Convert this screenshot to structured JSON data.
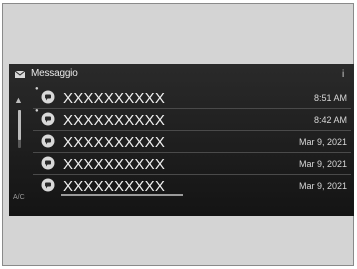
{
  "header": {
    "title": "Messaggio",
    "info_icon": "info-icon",
    "mail_icon": "envelope-icon"
  },
  "sidebar": {
    "up_icon": "up-arrow-icon",
    "ac_label": "A/C"
  },
  "messages": [
    {
      "sender": "XXXXXXXXXX",
      "time": "8:51 AM",
      "unread": true,
      "icon": "message-bubble-icon"
    },
    {
      "sender": "XXXXXXXXXX",
      "time": "8:42 AM",
      "unread": true,
      "icon": "message-bubble-icon"
    },
    {
      "sender": "XXXXXXXXXX",
      "time": "Mar 9, 2021",
      "unread": false,
      "icon": "message-bubble-icon"
    },
    {
      "sender": "XXXXXXXXXX",
      "time": "Mar 9, 2021",
      "unread": false,
      "icon": "message-bubble-icon"
    },
    {
      "sender": "XXXXXXXXXX",
      "time": "Mar 9, 2021",
      "unread": false,
      "icon": "message-bubble-icon"
    }
  ],
  "colors": {
    "screen_bg": "#1e1e1e",
    "text": "#f0f0f0",
    "divider": "#4a4a4a"
  }
}
